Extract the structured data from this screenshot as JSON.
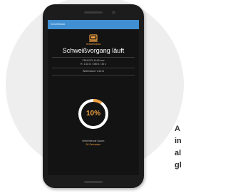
{
  "side_text": {
    "line1": "A",
    "line2": "in",
    "line3": "al",
    "line4": "gl"
  },
  "app": {
    "topbar_title": "Schweißdata",
    "brand": "Schweißdata",
    "title": "Schweißvorgang läuft",
    "fitting_line1": "FRIA EPL-B-63 mm",
    "fitting_line2": "R: 1.63 Ω / 380 s / 40 s",
    "resistance": "Widerstand: 1.63 Ω",
    "progress_percent": 10,
    "progress_text": "10%",
    "duration_label": "Verbleibende Dauer:",
    "duration_value": "54 Sekunden"
  },
  "colors": {
    "accent": "#f0a040",
    "topbar": "#3f8fd2",
    "screen_bg": "#131313",
    "ring_track": "#ffffff"
  },
  "icons": {
    "logo": "welding-machine-icon"
  }
}
